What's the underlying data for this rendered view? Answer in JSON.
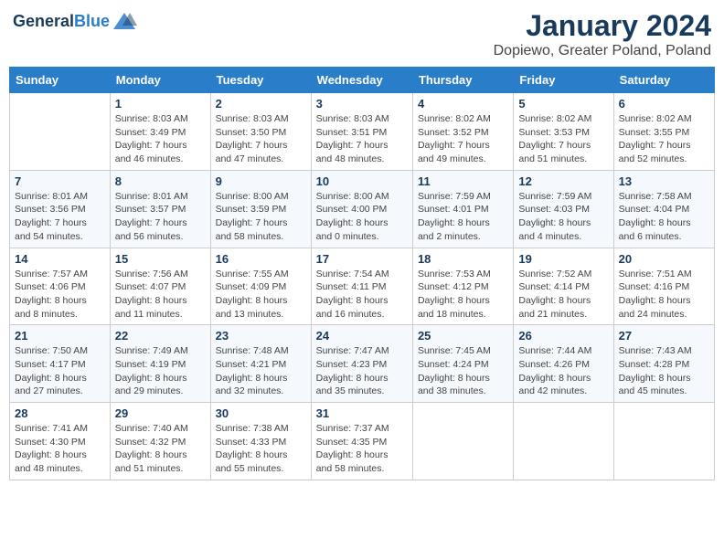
{
  "header": {
    "logo_line1": "General",
    "logo_line2": "Blue",
    "month": "January 2024",
    "location": "Dopiewo, Greater Poland, Poland"
  },
  "days_of_week": [
    "Sunday",
    "Monday",
    "Tuesday",
    "Wednesday",
    "Thursday",
    "Friday",
    "Saturday"
  ],
  "weeks": [
    [
      {
        "day": "",
        "info": ""
      },
      {
        "day": "1",
        "info": "Sunrise: 8:03 AM\nSunset: 3:49 PM\nDaylight: 7 hours\nand 46 minutes."
      },
      {
        "day": "2",
        "info": "Sunrise: 8:03 AM\nSunset: 3:50 PM\nDaylight: 7 hours\nand 47 minutes."
      },
      {
        "day": "3",
        "info": "Sunrise: 8:03 AM\nSunset: 3:51 PM\nDaylight: 7 hours\nand 48 minutes."
      },
      {
        "day": "4",
        "info": "Sunrise: 8:02 AM\nSunset: 3:52 PM\nDaylight: 7 hours\nand 49 minutes."
      },
      {
        "day": "5",
        "info": "Sunrise: 8:02 AM\nSunset: 3:53 PM\nDaylight: 7 hours\nand 51 minutes."
      },
      {
        "day": "6",
        "info": "Sunrise: 8:02 AM\nSunset: 3:55 PM\nDaylight: 7 hours\nand 52 minutes."
      }
    ],
    [
      {
        "day": "7",
        "info": "Sunrise: 8:01 AM\nSunset: 3:56 PM\nDaylight: 7 hours\nand 54 minutes."
      },
      {
        "day": "8",
        "info": "Sunrise: 8:01 AM\nSunset: 3:57 PM\nDaylight: 7 hours\nand 56 minutes."
      },
      {
        "day": "9",
        "info": "Sunrise: 8:00 AM\nSunset: 3:59 PM\nDaylight: 7 hours\nand 58 minutes."
      },
      {
        "day": "10",
        "info": "Sunrise: 8:00 AM\nSunset: 4:00 PM\nDaylight: 8 hours\nand 0 minutes."
      },
      {
        "day": "11",
        "info": "Sunrise: 7:59 AM\nSunset: 4:01 PM\nDaylight: 8 hours\nand 2 minutes."
      },
      {
        "day": "12",
        "info": "Sunrise: 7:59 AM\nSunset: 4:03 PM\nDaylight: 8 hours\nand 4 minutes."
      },
      {
        "day": "13",
        "info": "Sunrise: 7:58 AM\nSunset: 4:04 PM\nDaylight: 8 hours\nand 6 minutes."
      }
    ],
    [
      {
        "day": "14",
        "info": "Sunrise: 7:57 AM\nSunset: 4:06 PM\nDaylight: 8 hours\nand 8 minutes."
      },
      {
        "day": "15",
        "info": "Sunrise: 7:56 AM\nSunset: 4:07 PM\nDaylight: 8 hours\nand 11 minutes."
      },
      {
        "day": "16",
        "info": "Sunrise: 7:55 AM\nSunset: 4:09 PM\nDaylight: 8 hours\nand 13 minutes."
      },
      {
        "day": "17",
        "info": "Sunrise: 7:54 AM\nSunset: 4:11 PM\nDaylight: 8 hours\nand 16 minutes."
      },
      {
        "day": "18",
        "info": "Sunrise: 7:53 AM\nSunset: 4:12 PM\nDaylight: 8 hours\nand 18 minutes."
      },
      {
        "day": "19",
        "info": "Sunrise: 7:52 AM\nSunset: 4:14 PM\nDaylight: 8 hours\nand 21 minutes."
      },
      {
        "day": "20",
        "info": "Sunrise: 7:51 AM\nSunset: 4:16 PM\nDaylight: 8 hours\nand 24 minutes."
      }
    ],
    [
      {
        "day": "21",
        "info": "Sunrise: 7:50 AM\nSunset: 4:17 PM\nDaylight: 8 hours\nand 27 minutes."
      },
      {
        "day": "22",
        "info": "Sunrise: 7:49 AM\nSunset: 4:19 PM\nDaylight: 8 hours\nand 29 minutes."
      },
      {
        "day": "23",
        "info": "Sunrise: 7:48 AM\nSunset: 4:21 PM\nDaylight: 8 hours\nand 32 minutes."
      },
      {
        "day": "24",
        "info": "Sunrise: 7:47 AM\nSunset: 4:23 PM\nDaylight: 8 hours\nand 35 minutes."
      },
      {
        "day": "25",
        "info": "Sunrise: 7:45 AM\nSunset: 4:24 PM\nDaylight: 8 hours\nand 38 minutes."
      },
      {
        "day": "26",
        "info": "Sunrise: 7:44 AM\nSunset: 4:26 PM\nDaylight: 8 hours\nand 42 minutes."
      },
      {
        "day": "27",
        "info": "Sunrise: 7:43 AM\nSunset: 4:28 PM\nDaylight: 8 hours\nand 45 minutes."
      }
    ],
    [
      {
        "day": "28",
        "info": "Sunrise: 7:41 AM\nSunset: 4:30 PM\nDaylight: 8 hours\nand 48 minutes."
      },
      {
        "day": "29",
        "info": "Sunrise: 7:40 AM\nSunset: 4:32 PM\nDaylight: 8 hours\nand 51 minutes."
      },
      {
        "day": "30",
        "info": "Sunrise: 7:38 AM\nSunset: 4:33 PM\nDaylight: 8 hours\nand 55 minutes."
      },
      {
        "day": "31",
        "info": "Sunrise: 7:37 AM\nSunset: 4:35 PM\nDaylight: 8 hours\nand 58 minutes."
      },
      {
        "day": "",
        "info": ""
      },
      {
        "day": "",
        "info": ""
      },
      {
        "day": "",
        "info": ""
      }
    ]
  ]
}
